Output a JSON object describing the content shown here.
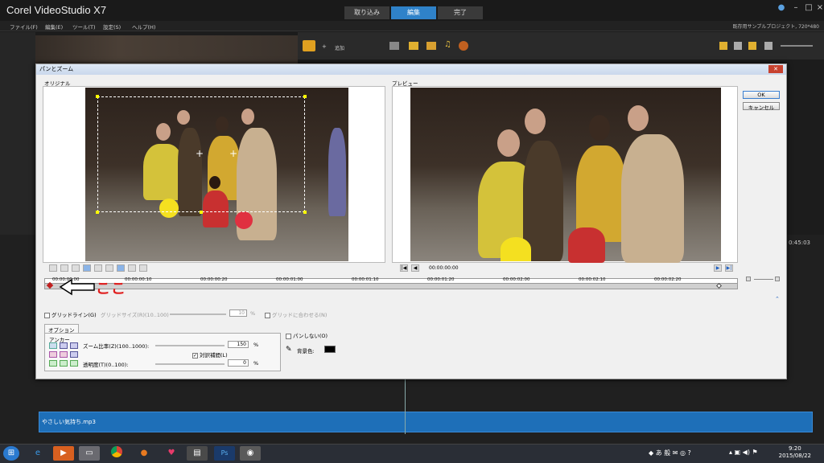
{
  "app": {
    "title": "Corel  VideoStudio X7"
  },
  "tabs": [
    {
      "label": "取り込み"
    },
    {
      "label": "編集"
    },
    {
      "label": "完了"
    }
  ],
  "menu": [
    {
      "label": "ファイル(F)"
    },
    {
      "label": "編集(E)"
    },
    {
      "label": "ツール(T)"
    },
    {
      "label": "設定(S)"
    },
    {
      "label": "ヘルプ(H)"
    }
  ],
  "project_info": "既存用サンプルプロジェクト, 720*480",
  "library": {
    "add_label": "追加",
    "sample_label": "サンプル"
  },
  "dialog": {
    "title": "パンとズーム",
    "original_label": "オリジナル",
    "preview_label": "プレビュー",
    "ok": "OK",
    "cancel": "キャンセル",
    "timecode": "00:00:00:00",
    "ticks": [
      "00:00:00:00",
      "00:00:00:10",
      "00:00:00:20",
      "00:00:01:00",
      "00:00:01:10",
      "00:00:01:20",
      "00:00:02:00",
      "00:00:02:10",
      "00:00:02:20"
    ],
    "grid_line": "グリッドライン(G)",
    "grid_size": "グリッドサイズ(R)(10..100)",
    "grid_size_value": "10",
    "snap_grid": "グリッドに合わせる(N)",
    "options_tab": "オプション",
    "anchor_label": "アンカー",
    "zoom_label": "ズーム比率(Z)(100..1000):",
    "zoom_value": "150",
    "aspect_label": "対訳補間(L)",
    "transparency_label": "透明度(T)(0..100):",
    "transparency_value": "0",
    "no_pan_label": "パンしない(O)",
    "bg_label": "背景色:",
    "percent": "%"
  },
  "annotation": {
    "text": "ここ"
  },
  "timeline": {
    "audio_clip": "やさしい気持ち.mp3",
    "timecode_right": "0:45:03"
  },
  "taskbar": {
    "time": "9:20",
    "date": "2015/08/22"
  },
  "colors": {
    "accent": "#2f82c9",
    "annotation": "#e02020",
    "audio_track": "#1e6fb8"
  }
}
